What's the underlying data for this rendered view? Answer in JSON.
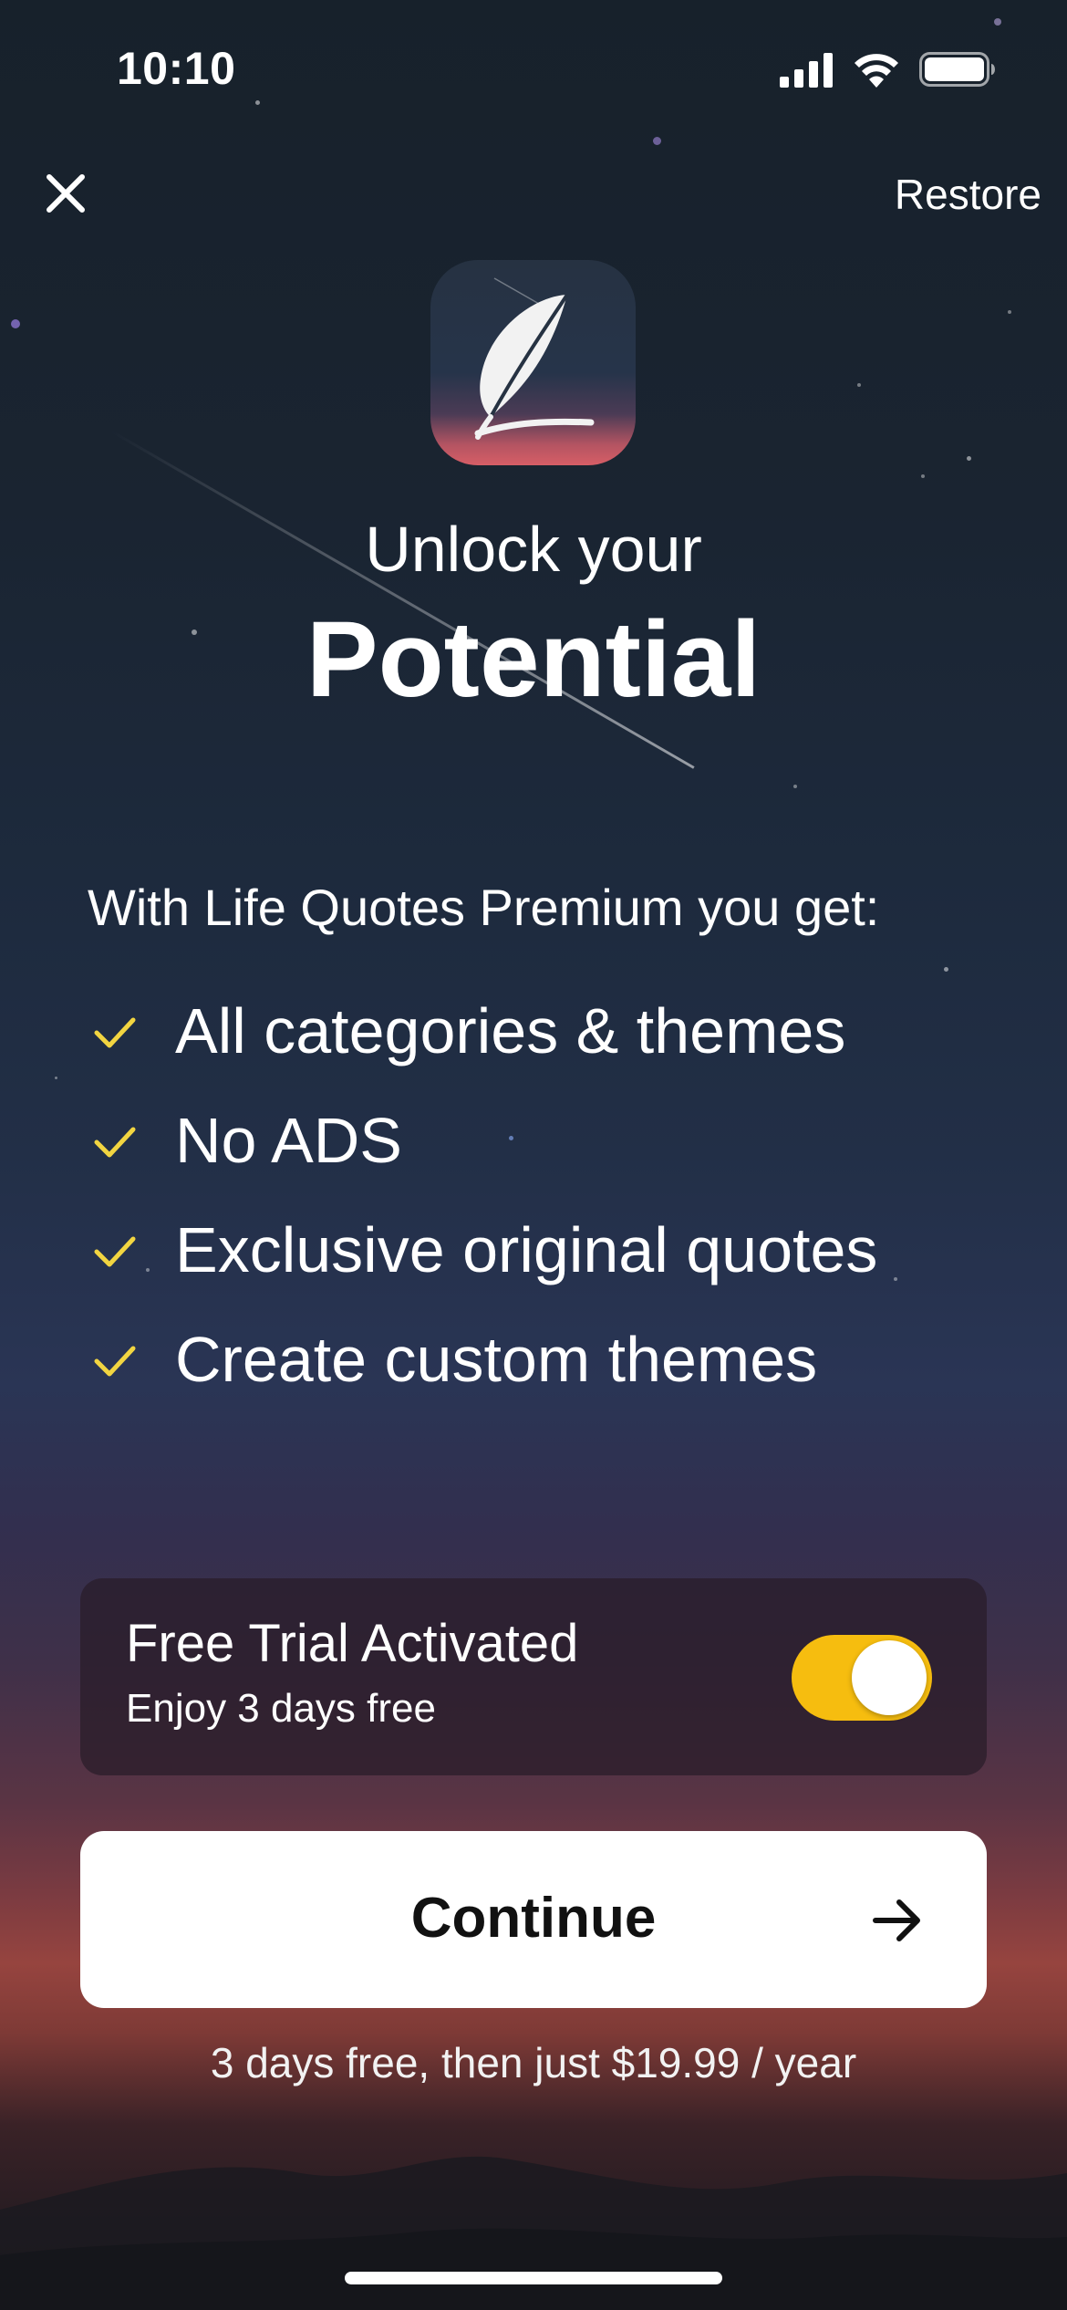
{
  "status_bar": {
    "time": "10:10"
  },
  "header": {
    "close_icon": "close-icon",
    "restore_label": "Restore"
  },
  "app_icon": {
    "icon": "feather-quill-icon"
  },
  "headline": {
    "line1": "Unlock your",
    "line2": "Potential"
  },
  "features": {
    "intro": "With Life Quotes Premium you get:",
    "items": [
      {
        "label": "All categories & themes"
      },
      {
        "label": "No ADS"
      },
      {
        "label": "Exclusive original quotes"
      },
      {
        "label": "Create custom themes"
      }
    ],
    "check_color": "#f2d541"
  },
  "trial": {
    "title": "Free Trial Activated",
    "subtitle": "Enjoy 3 days free",
    "enabled": true,
    "toggle_color": "#f6bd0f"
  },
  "continue": {
    "label": "Continue",
    "icon": "arrow-right-icon"
  },
  "price_note": "3 days free, then just $19.99 / year"
}
